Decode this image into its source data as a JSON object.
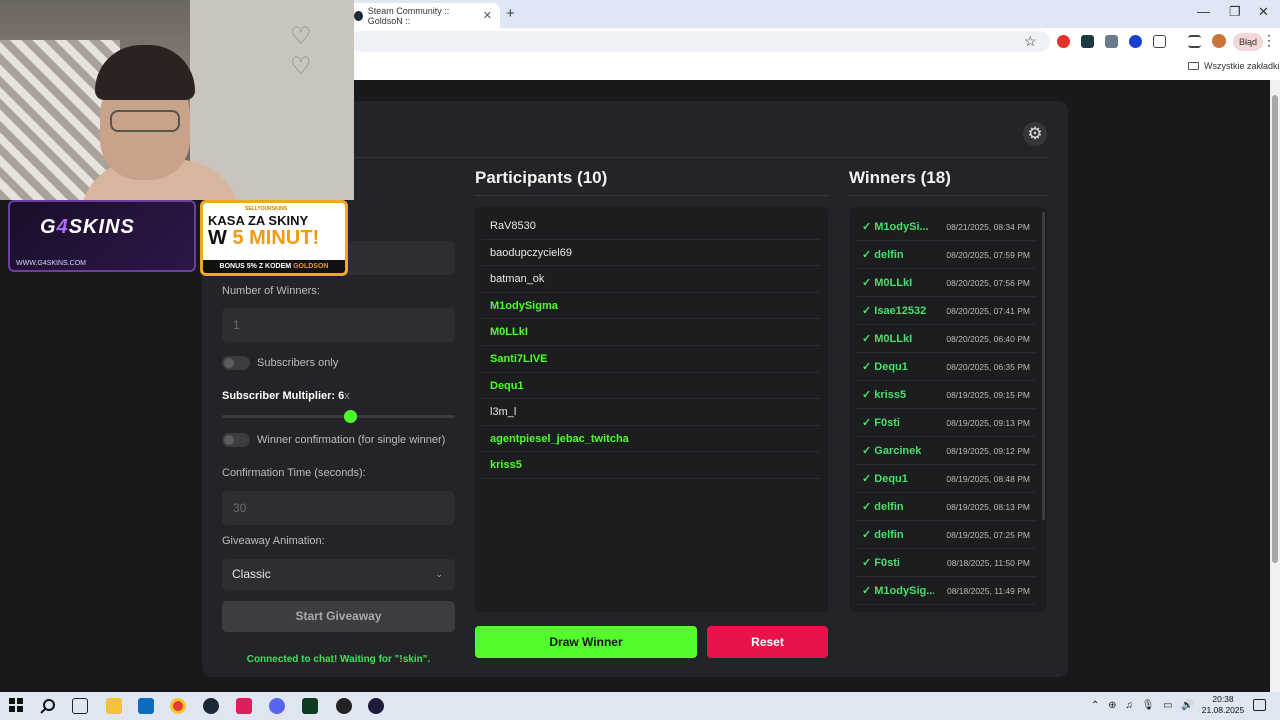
{
  "browser": {
    "tab_title": "Steam Community :: GoldsoN ::",
    "tab_close": "✕",
    "new_tab": "+",
    "window_controls": [
      "—",
      "❐",
      "✕"
    ],
    "star_icon": "☆",
    "profile_status": "Błąd",
    "menu": "⋮",
    "bookmarks_label": "Wszystkie zakładki"
  },
  "settings": {
    "gear_icon": "⚙",
    "winners_count_label": "Number of Winners:",
    "winners_count_value": "1",
    "subscribers_only_label": "Subscribers only",
    "multiplier_label": "Subscriber Multiplier: 6",
    "multiplier_suffix": "x",
    "multiplier_value": 6,
    "winner_confirmation_label": "Winner confirmation (for single winner)",
    "confirmation_time_label": "Confirmation Time (seconds):",
    "confirmation_time_value": "30",
    "animation_label": "Giveaway Animation:",
    "animation_value": "Classic",
    "chevron": "⌄",
    "start_button": "Start Giveaway",
    "status": "Connected to chat! Waiting for \"!skin\"."
  },
  "participants": {
    "title": "Participants (10)",
    "items": [
      {
        "name": "RaV8530",
        "highlight": false
      },
      {
        "name": "baodupczyciel69",
        "highlight": false
      },
      {
        "name": "batman_ok",
        "highlight": false
      },
      {
        "name": "M1odySigma",
        "highlight": true
      },
      {
        "name": "M0LLkI",
        "highlight": true
      },
      {
        "name": "Santi7LIVE",
        "highlight": true
      },
      {
        "name": "Dequ1",
        "highlight": true
      },
      {
        "name": "l3m_l",
        "highlight": false
      },
      {
        "name": "agentpiesel_jebac_twitcha",
        "highlight": true
      },
      {
        "name": "kriss5",
        "highlight": true
      }
    ],
    "draw_button": "Draw Winner",
    "reset_button": "Reset"
  },
  "winners": {
    "title": "Winners (18)",
    "items": [
      {
        "name": "✓ M1odySi...",
        "time": "08/21/2025, 08:34 PM"
      },
      {
        "name": "✓ delfin",
        "time": "08/20/2025, 07:59 PM"
      },
      {
        "name": "✓ M0LLkI",
        "time": "08/20/2025, 07:56 PM"
      },
      {
        "name": "✓ Isae12532",
        "time": "08/20/2025, 07:41 PM"
      },
      {
        "name": "✓ M0LLkI",
        "time": "08/20/2025, 06:40 PM"
      },
      {
        "name": "✓ Dequ1",
        "time": "08/20/2025, 06:35 PM"
      },
      {
        "name": "✓ kriss5",
        "time": "08/19/2025, 09:15 PM"
      },
      {
        "name": "✓ F0sti",
        "time": "08/19/2025, 09:13 PM"
      },
      {
        "name": "✓ Garcinek",
        "time": "08/19/2025, 09:12 PM"
      },
      {
        "name": "✓ Dequ1",
        "time": "08/19/2025, 08:48 PM"
      },
      {
        "name": "✓ delfin",
        "time": "08/19/2025, 08:13 PM"
      },
      {
        "name": "✓ delfin",
        "time": "08/19/2025, 07:25 PM"
      },
      {
        "name": "✓ F0sti",
        "time": "08/18/2025, 11:50 PM"
      },
      {
        "name": "✓ M1odySig...",
        "time": "08/18/2025, 11:49 PM"
      }
    ]
  },
  "overlay": {
    "g4_logo_pre": "G",
    "g4_logo_four": "4",
    "g4_logo_post": "SKINS",
    "g4_url": "WWW.G4SKINS.COM",
    "kasa_brand": "SELLYOURSKINS",
    "kasa_line1": "KASA ZA SKINY",
    "kasa_line2_pre": "W ",
    "kasa_line2_hl": "5 MINUT!",
    "kasa_bonus_pre": "BONUS 5% Z KODEM ",
    "kasa_bonus_hl": "GOLDSON"
  },
  "taskbar": {
    "tray": "⌃ ⊕ ♫ 🎙 ▭ 🔊",
    "time": "20:38",
    "date": "21.08.2025"
  },
  "colors": {
    "accent_green": "#53fc2b",
    "participant_green": "#4cff2a",
    "winner_green": "#4ade6a",
    "reset_red": "#e8134a"
  }
}
